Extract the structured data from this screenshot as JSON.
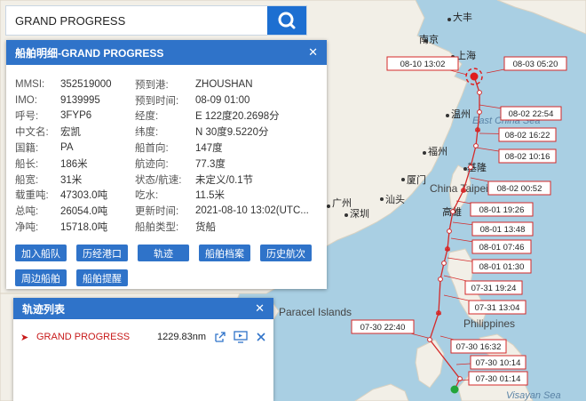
{
  "search": {
    "value": "GRAND PROGRESS"
  },
  "detail": {
    "title": "船舶明细-GRAND PROGRESS",
    "rows": [
      {
        "l1": "MMSI:",
        "v1": "352519000",
        "l2": "预到港:",
        "v2": "ZHOUSHAN"
      },
      {
        "l1": "IMO:",
        "v1": "9139995",
        "l2": "预到时间:",
        "v2": "08-09 01:00"
      },
      {
        "l1": "呼号:",
        "v1": "3FYP6",
        "l2": "经度:",
        "v2": "E 122度20.2698分"
      },
      {
        "l1": "中文名:",
        "v1": "宏凯",
        "l2": "纬度:",
        "v2": "N 30度9.5220分"
      },
      {
        "l1": "国籍:",
        "v1": "PA",
        "l2": "船首向:",
        "v2": "147度"
      },
      {
        "l1": "船长:",
        "v1": "186米",
        "l2": "航迹向:",
        "v2": "77.3度"
      },
      {
        "l1": "船宽:",
        "v1": "31米",
        "l2": "状态/航速:",
        "v2": "未定义/0.1节"
      },
      {
        "l1": "载重吨:",
        "v1": "47303.0吨",
        "l2": "吃水:",
        "v2": "11.5米"
      },
      {
        "l1": "总吨:",
        "v1": "26054.0吨",
        "l2": "更新时间:",
        "v2": "2021-08-10 13:02(UTC..."
      },
      {
        "l1": "净吨:",
        "v1": "15718.0吨",
        "l2": "船舶类型:",
        "v2": "货船"
      }
    ],
    "buttons": [
      "加入船队",
      "历经港口",
      "轨迹",
      "船舶档案",
      "历史航次",
      "周边船舶",
      "船舶提醒"
    ]
  },
  "track_list": {
    "title": "轨迹列表",
    "ship": "GRAND PROGRESS",
    "distance": "1229.83nm"
  },
  "map": {
    "cities": [
      "大丰",
      "南京",
      "上海",
      "温州",
      "福州",
      "厦门",
      "汕头",
      "广州",
      "深圳",
      "基隆",
      "高雄"
    ],
    "sea_labels": [
      "East China Sea",
      "Visayan Sea"
    ],
    "region_labels": [
      "China Taipei",
      "Paracel Islands",
      "Philippines"
    ],
    "track_labels": [
      "08-10 13:02",
      "08-03 05:20",
      "08-02 22:54",
      "08-02 16:22",
      "08-02 10:16",
      "08-02 00:52",
      "08-01 19:26",
      "08-01 13:48",
      "08-01 07:46",
      "08-01 01:30",
      "07-31 19:24",
      "07-31 13:04",
      "07-30 22:40",
      "07-30 16:32",
      "07-30 10:14",
      "07-30 01:14"
    ],
    "colors": {
      "sea": "#a9cfe3",
      "land": "#f2efe7",
      "track": "#d42a2a"
    }
  }
}
